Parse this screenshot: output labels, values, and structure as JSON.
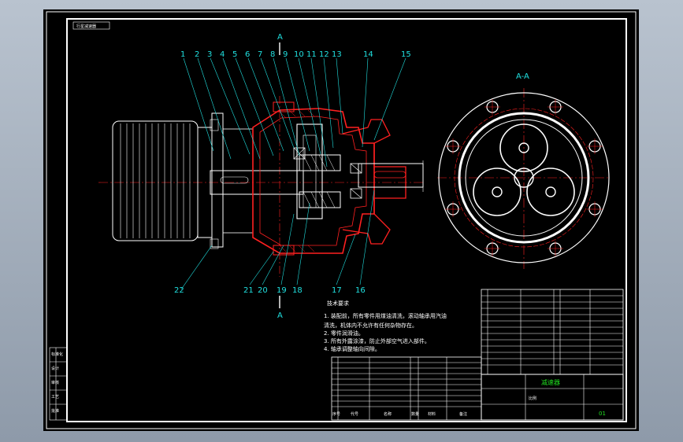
{
  "drawing": {
    "tag_label": "行星减速器",
    "section_label": "A",
    "section_view_label": "A-A",
    "part_numbers": [
      "1",
      "2",
      "3",
      "4",
      "5",
      "6",
      "7",
      "8",
      "9",
      "10",
      "11",
      "12",
      "13",
      "14",
      "15"
    ],
    "part_numbers_bottom": [
      "22",
      "21",
      "20",
      "19",
      "18",
      "17",
      "16"
    ],
    "tech_title": "技术要求",
    "tech_notes": [
      "1. 装配前，所有零件用煤油清洗，滚动轴承用汽油",
      "清洗，机体内不允许有任何杂物存在。",
      "2. 零件润滑油。",
      "3. 所有外露涂漆，防止外部空气进入部件。",
      "4. 轴承调整轴向间隙。"
    ],
    "title_block": {
      "drawing_name": "减速器",
      "sheet_no": "01",
      "scale_label": "比例",
      "header_cols": [
        "序号",
        "代号",
        "名称",
        "数量",
        "材料",
        "备注"
      ],
      "left_side_labels": [
        "标准化",
        "设计",
        "审核",
        "工艺",
        "批准"
      ]
    }
  }
}
